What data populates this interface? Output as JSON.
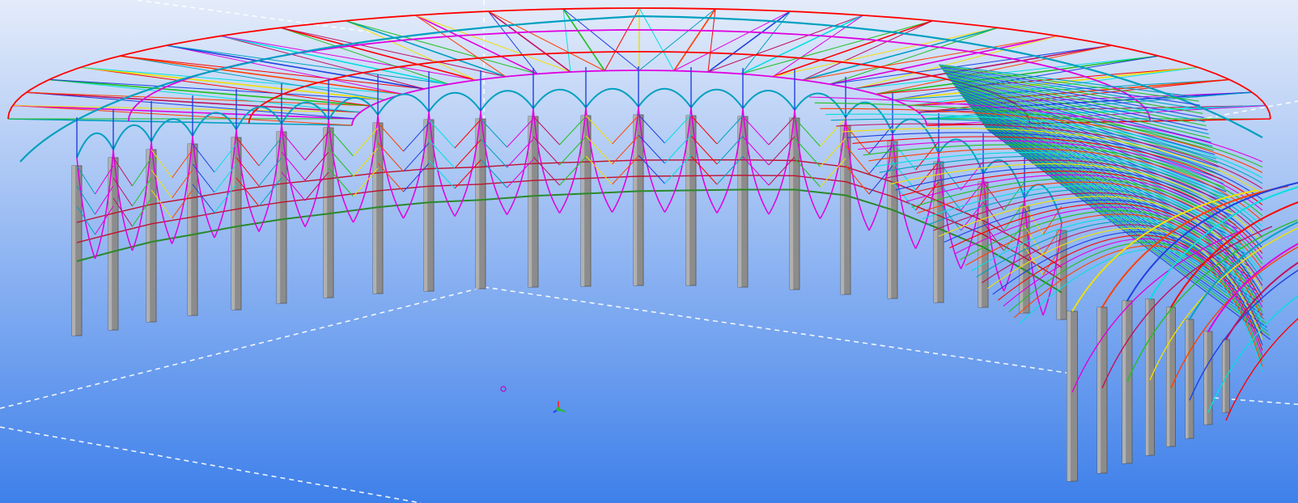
{
  "viewport": {
    "background": {
      "top_color": "#e4ecfa",
      "bottom_color": "#3e80ea"
    },
    "grid_line_color": "#ffffff",
    "model": {
      "column_color": "#8c8c8c",
      "member_colors": [
        "#00a0c0",
        "#e000e0",
        "#c01060",
        "#20c020",
        "#f0e000",
        "#ff4000",
        "#2040e0",
        "#00e0e0",
        "#ff0000"
      ],
      "ring_beam_color": "#2a8a2a",
      "purlin_color": "#c01030"
    },
    "origin_marker_icons": [
      "work-plane-origin-icon",
      "coordinate-axes-icon"
    ]
  }
}
